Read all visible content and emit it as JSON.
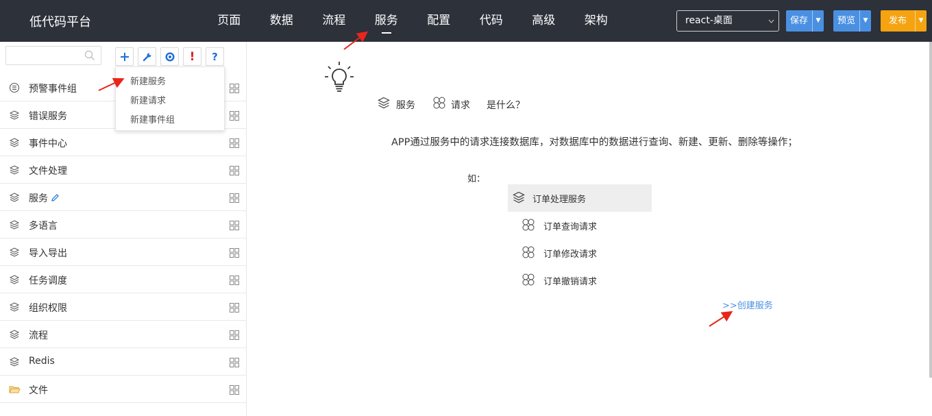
{
  "app": {
    "title": "低代码平台"
  },
  "nav": [
    {
      "label": "页面"
    },
    {
      "label": "数据"
    },
    {
      "label": "流程"
    },
    {
      "label": "服务",
      "active": true
    },
    {
      "label": "配置"
    },
    {
      "label": "代码"
    },
    {
      "label": "高级"
    },
    {
      "label": "架构"
    }
  ],
  "env_select": {
    "value": "react-桌面"
  },
  "buttons": {
    "save": "保存",
    "preview": "预览",
    "publish": "发布"
  },
  "colors": {
    "topbar": "#2c313a",
    "blue_button": "#4a90e2",
    "orange_button": "#f5a311",
    "link": "#4a90e2",
    "plus": "#1e6fd9",
    "warn": "#e02020"
  },
  "sidebar": {
    "search_placeholder": "",
    "tools": [
      {
        "name": "add",
        "glyph": "+"
      },
      {
        "name": "wrench-icon"
      },
      {
        "name": "target-icon"
      },
      {
        "name": "warning",
        "glyph": "!"
      },
      {
        "name": "help",
        "glyph": "?"
      }
    ],
    "items": [
      {
        "label": "预警事件组",
        "icon": "list-circle-icon"
      },
      {
        "label": "错误服务",
        "icon": "layers-icon"
      },
      {
        "label": "事件中心",
        "icon": "layers-icon"
      },
      {
        "label": "文件处理",
        "icon": "layers-icon"
      },
      {
        "label": "服务",
        "icon": "layers-icon",
        "editing": true
      },
      {
        "label": "多语言",
        "icon": "layers-icon"
      },
      {
        "label": "导入导出",
        "icon": "layers-icon"
      },
      {
        "label": "任务调度",
        "icon": "layers-icon"
      },
      {
        "label": "组织权限",
        "icon": "layers-icon"
      },
      {
        "label": "流程",
        "icon": "layers-icon"
      },
      {
        "label": "Redis",
        "icon": "layers-icon"
      },
      {
        "label": "文件",
        "icon": "folder-icon"
      }
    ]
  },
  "dropdown": {
    "items": [
      "新建服务",
      "新建请求",
      "新建事件组"
    ]
  },
  "intro": {
    "service_label": "服务",
    "request_label": "请求",
    "question": "是什么？",
    "description": "APP通过服务中的请求连接数据库，对数据库中的数据进行查询、新建、更新、删除等操作；",
    "example_prefix": "如：",
    "example_service": "订单处理服务",
    "example_requests": [
      "订单查询请求",
      "订单修改请求",
      "订单撤销请求"
    ],
    "create_link": ">>创建服务"
  }
}
